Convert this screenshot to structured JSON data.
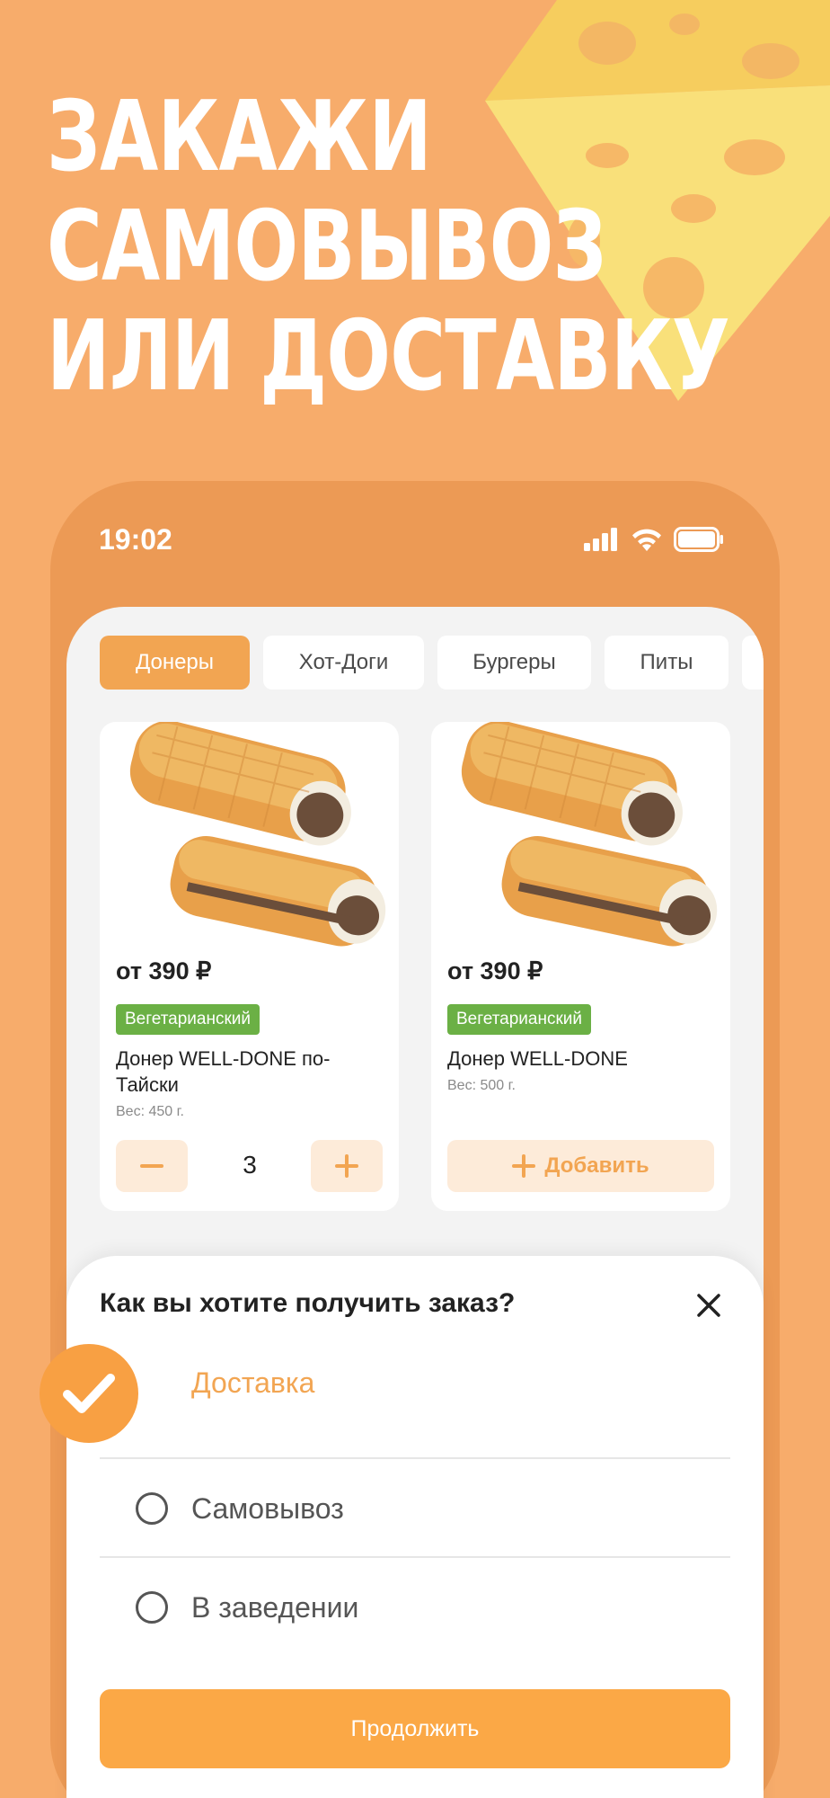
{
  "promo": {
    "headline_lines": [
      "ЗАКАЖИ",
      "САМОВЫВОЗ",
      "ИЛИ ДОСТАВКУ"
    ]
  },
  "status_bar": {
    "time": "19:02",
    "icons": [
      "signal-icon",
      "wifi-icon",
      "battery-icon"
    ]
  },
  "categories": {
    "tabs": [
      {
        "label": "Донеры",
        "active": true
      },
      {
        "label": "Хот-Доги",
        "active": false
      },
      {
        "label": "Бургеры",
        "active": false
      },
      {
        "label": "Питы",
        "active": false
      }
    ]
  },
  "products": [
    {
      "price": "от 390 ₽",
      "badge": "Вегетарианский",
      "name": "Донер WELL-DONE по-Тайски",
      "weight": "Вес: 450 г.",
      "quantity": "3"
    },
    {
      "price": "от 390 ₽",
      "badge": "Вегетарианский",
      "name": "Донер WELL-DONE",
      "weight": "Вес: 500 г.",
      "add_label": "Добавить"
    }
  ],
  "order_sheet": {
    "title": "Как вы хотите получить заказ?",
    "options": [
      {
        "label": "Доставка",
        "selected": true
      },
      {
        "label": "Самовывоз",
        "selected": false
      },
      {
        "label": "В заведении",
        "selected": false
      }
    ],
    "continue_label": "Продолжить"
  },
  "colors": {
    "background": "#F7AC6B",
    "phone_frame": "#EC9A55",
    "accent": "#F2A552",
    "badge": "#6BB045",
    "button": "#FBA846"
  }
}
